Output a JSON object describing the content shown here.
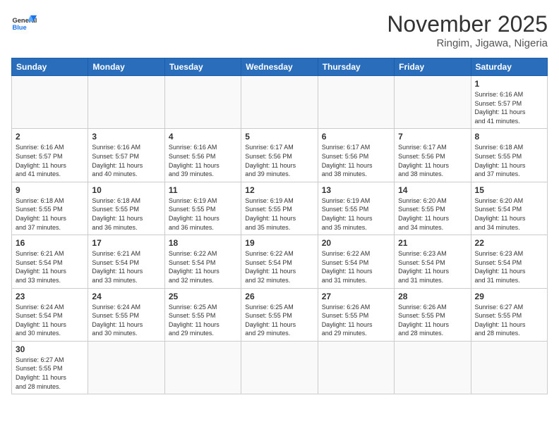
{
  "header": {
    "logo_general": "General",
    "logo_blue": "Blue",
    "month_title": "November 2025",
    "subtitle": "Ringim, Jigawa, Nigeria"
  },
  "days_of_week": [
    "Sunday",
    "Monday",
    "Tuesday",
    "Wednesday",
    "Thursday",
    "Friday",
    "Saturday"
  ],
  "weeks": [
    [
      {
        "day": "",
        "text": ""
      },
      {
        "day": "",
        "text": ""
      },
      {
        "day": "",
        "text": ""
      },
      {
        "day": "",
        "text": ""
      },
      {
        "day": "",
        "text": ""
      },
      {
        "day": "",
        "text": ""
      },
      {
        "day": "1",
        "text": "Sunrise: 6:16 AM\nSunset: 5:57 PM\nDaylight: 11 hours\nand 41 minutes."
      }
    ],
    [
      {
        "day": "2",
        "text": "Sunrise: 6:16 AM\nSunset: 5:57 PM\nDaylight: 11 hours\nand 41 minutes."
      },
      {
        "day": "3",
        "text": "Sunrise: 6:16 AM\nSunset: 5:57 PM\nDaylight: 11 hours\nand 40 minutes."
      },
      {
        "day": "4",
        "text": "Sunrise: 6:16 AM\nSunset: 5:56 PM\nDaylight: 11 hours\nand 39 minutes."
      },
      {
        "day": "5",
        "text": "Sunrise: 6:17 AM\nSunset: 5:56 PM\nDaylight: 11 hours\nand 39 minutes."
      },
      {
        "day": "6",
        "text": "Sunrise: 6:17 AM\nSunset: 5:56 PM\nDaylight: 11 hours\nand 38 minutes."
      },
      {
        "day": "7",
        "text": "Sunrise: 6:17 AM\nSunset: 5:56 PM\nDaylight: 11 hours\nand 38 minutes."
      },
      {
        "day": "8",
        "text": "Sunrise: 6:18 AM\nSunset: 5:55 PM\nDaylight: 11 hours\nand 37 minutes."
      }
    ],
    [
      {
        "day": "9",
        "text": "Sunrise: 6:18 AM\nSunset: 5:55 PM\nDaylight: 11 hours\nand 37 minutes."
      },
      {
        "day": "10",
        "text": "Sunrise: 6:18 AM\nSunset: 5:55 PM\nDaylight: 11 hours\nand 36 minutes."
      },
      {
        "day": "11",
        "text": "Sunrise: 6:19 AM\nSunset: 5:55 PM\nDaylight: 11 hours\nand 36 minutes."
      },
      {
        "day": "12",
        "text": "Sunrise: 6:19 AM\nSunset: 5:55 PM\nDaylight: 11 hours\nand 35 minutes."
      },
      {
        "day": "13",
        "text": "Sunrise: 6:19 AM\nSunset: 5:55 PM\nDaylight: 11 hours\nand 35 minutes."
      },
      {
        "day": "14",
        "text": "Sunrise: 6:20 AM\nSunset: 5:55 PM\nDaylight: 11 hours\nand 34 minutes."
      },
      {
        "day": "15",
        "text": "Sunrise: 6:20 AM\nSunset: 5:54 PM\nDaylight: 11 hours\nand 34 minutes."
      }
    ],
    [
      {
        "day": "16",
        "text": "Sunrise: 6:21 AM\nSunset: 5:54 PM\nDaylight: 11 hours\nand 33 minutes."
      },
      {
        "day": "17",
        "text": "Sunrise: 6:21 AM\nSunset: 5:54 PM\nDaylight: 11 hours\nand 33 minutes."
      },
      {
        "day": "18",
        "text": "Sunrise: 6:22 AM\nSunset: 5:54 PM\nDaylight: 11 hours\nand 32 minutes."
      },
      {
        "day": "19",
        "text": "Sunrise: 6:22 AM\nSunset: 5:54 PM\nDaylight: 11 hours\nand 32 minutes."
      },
      {
        "day": "20",
        "text": "Sunrise: 6:22 AM\nSunset: 5:54 PM\nDaylight: 11 hours\nand 31 minutes."
      },
      {
        "day": "21",
        "text": "Sunrise: 6:23 AM\nSunset: 5:54 PM\nDaylight: 11 hours\nand 31 minutes."
      },
      {
        "day": "22",
        "text": "Sunrise: 6:23 AM\nSunset: 5:54 PM\nDaylight: 11 hours\nand 31 minutes."
      }
    ],
    [
      {
        "day": "23",
        "text": "Sunrise: 6:24 AM\nSunset: 5:54 PM\nDaylight: 11 hours\nand 30 minutes."
      },
      {
        "day": "24",
        "text": "Sunrise: 6:24 AM\nSunset: 5:55 PM\nDaylight: 11 hours\nand 30 minutes."
      },
      {
        "day": "25",
        "text": "Sunrise: 6:25 AM\nSunset: 5:55 PM\nDaylight: 11 hours\nand 29 minutes."
      },
      {
        "day": "26",
        "text": "Sunrise: 6:25 AM\nSunset: 5:55 PM\nDaylight: 11 hours\nand 29 minutes."
      },
      {
        "day": "27",
        "text": "Sunrise: 6:26 AM\nSunset: 5:55 PM\nDaylight: 11 hours\nand 29 minutes."
      },
      {
        "day": "28",
        "text": "Sunrise: 6:26 AM\nSunset: 5:55 PM\nDaylight: 11 hours\nand 28 minutes."
      },
      {
        "day": "29",
        "text": "Sunrise: 6:27 AM\nSunset: 5:55 PM\nDaylight: 11 hours\nand 28 minutes."
      }
    ],
    [
      {
        "day": "30",
        "text": "Sunrise: 6:27 AM\nSunset: 5:55 PM\nDaylight: 11 hours\nand 28 minutes."
      },
      {
        "day": "",
        "text": ""
      },
      {
        "day": "",
        "text": ""
      },
      {
        "day": "",
        "text": ""
      },
      {
        "day": "",
        "text": ""
      },
      {
        "day": "",
        "text": ""
      },
      {
        "day": "",
        "text": ""
      }
    ]
  ]
}
